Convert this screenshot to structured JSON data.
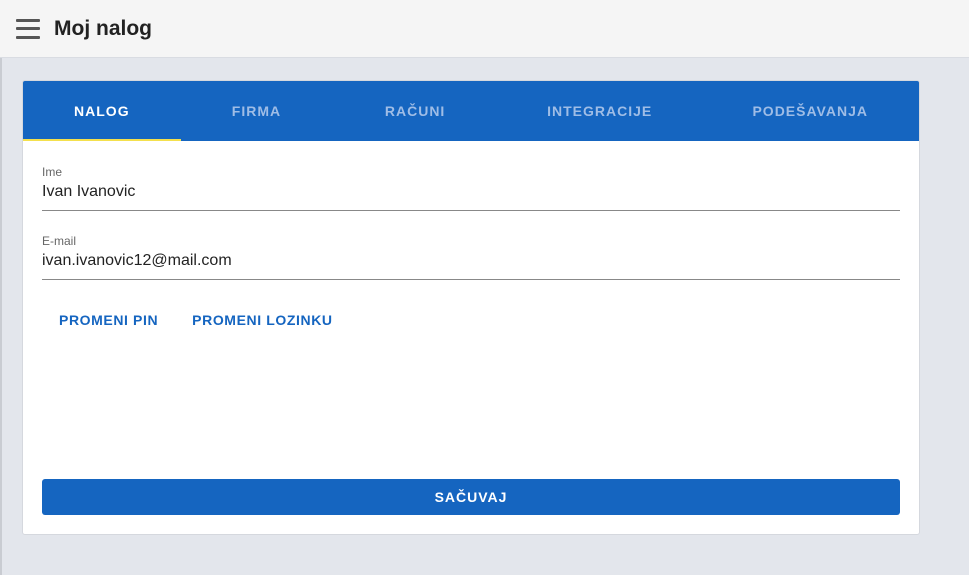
{
  "header": {
    "menu_icon": "hamburger-menu-icon",
    "title": "Moj nalog"
  },
  "tabs": [
    {
      "label": "NALOG",
      "active": true
    },
    {
      "label": "FIRMA",
      "active": false
    },
    {
      "label": "RAČUNI",
      "active": false
    },
    {
      "label": "INTEGRACIJE",
      "active": false
    },
    {
      "label": "PODEŠAVANJA",
      "active": false
    }
  ],
  "form": {
    "name": {
      "label": "Ime",
      "value": "Ivan Ivanovic"
    },
    "email": {
      "label": "E-mail",
      "value": "ivan.ivanovic12@mail.com"
    }
  },
  "actions": {
    "change_pin": "PROMENI PIN",
    "change_password": "PROMENI LOZINKU",
    "save": "SAČUVAJ"
  },
  "colors": {
    "primary": "#1565c0",
    "tab_indicator": "#f4e04d",
    "background": "#e3e6ec"
  }
}
